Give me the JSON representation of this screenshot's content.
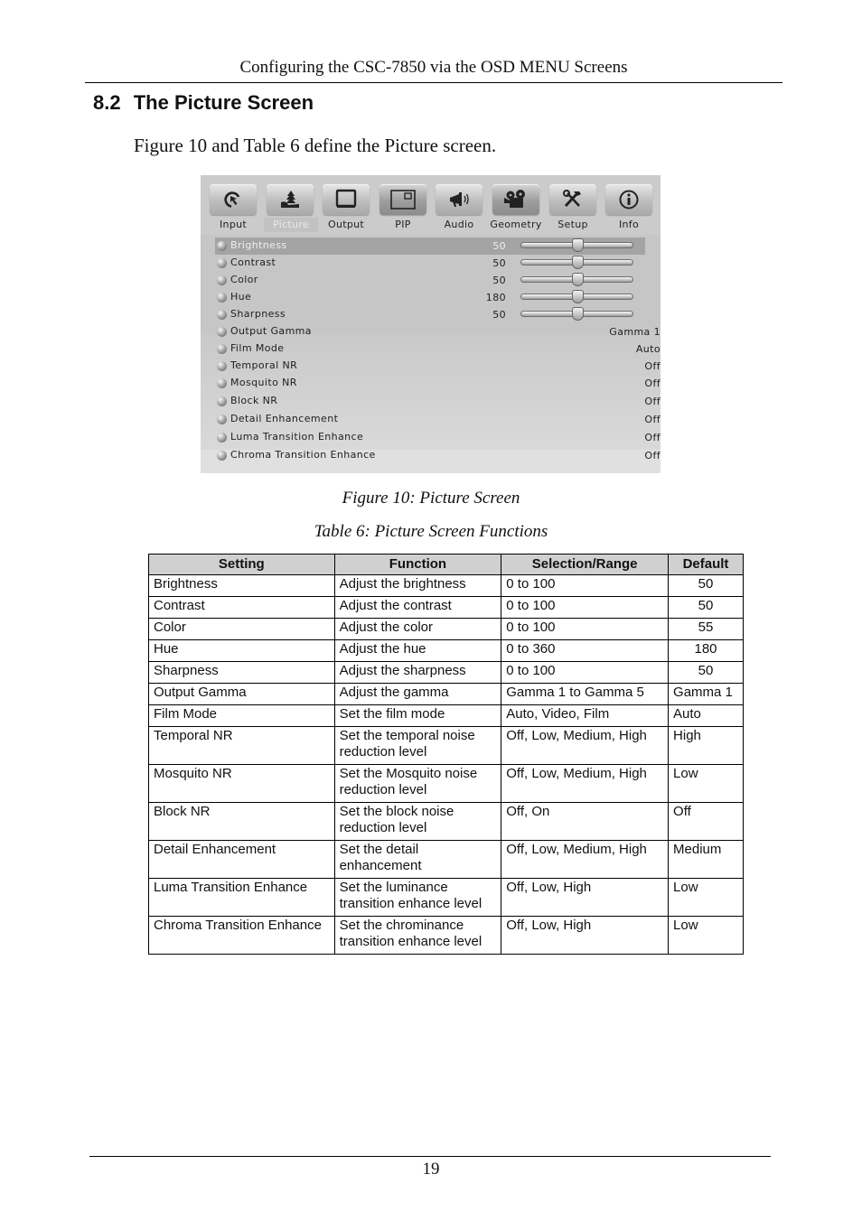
{
  "running_header": "Configuring the CSC-7850 via the OSD MENU Screens",
  "section": {
    "number": "8.2",
    "title": "The Picture Screen"
  },
  "intro_text": "Figure 10 and Table 6 define the Picture screen.",
  "osd": {
    "tabs": [
      {
        "label": "Input",
        "icon": "cursor-arrow-icon",
        "active": false
      },
      {
        "label": "Picture",
        "icon": "landscape-tree-icon",
        "active": true
      },
      {
        "label": "Output",
        "icon": "tv-monitor-icon",
        "active": false
      },
      {
        "label": "PIP",
        "icon": "picture-in-picture-icon",
        "active": false
      },
      {
        "label": "Audio",
        "icon": "megaphone-icon",
        "active": false
      },
      {
        "label": "Geometry",
        "icon": "film-projector-icon",
        "active": false
      },
      {
        "label": "Setup",
        "icon": "tools-icon",
        "active": false
      },
      {
        "label": "Info",
        "icon": "info-icon",
        "active": false
      }
    ],
    "items": [
      {
        "name": "Brightness",
        "value": "50",
        "slider": 0.5,
        "selected": true
      },
      {
        "name": "Contrast",
        "value": "50",
        "slider": 0.5
      },
      {
        "name": "Color",
        "value": "50",
        "slider": 0.5
      },
      {
        "name": "Hue",
        "value": "180",
        "slider": 0.5
      },
      {
        "name": "Sharpness",
        "value": "50",
        "slider": 0.5
      },
      {
        "name": "Output Gamma",
        "option": "Gamma 1"
      },
      {
        "name": "Film Mode",
        "option": "Auto"
      },
      {
        "name": "Temporal NR",
        "option": "Off"
      },
      {
        "name": "Mosquito NR",
        "option": "Off"
      },
      {
        "name": "Block NR",
        "option": "Off"
      },
      {
        "name": "Detail Enhancement",
        "option": "Off"
      },
      {
        "name": "Luma Transition Enhance",
        "option": "Off"
      },
      {
        "name": "Chroma Transition Enhance",
        "option": "Off"
      }
    ]
  },
  "figure_caption": "Figure 10: Picture Screen",
  "table_caption": "Table 6: Picture Screen Functions",
  "table": {
    "headers": [
      "Setting",
      "Function",
      "Selection/Range",
      "Default"
    ],
    "rows": [
      [
        "Brightness",
        "Adjust the brightness",
        "0 to 100",
        "50"
      ],
      [
        "Contrast",
        "Adjust the contrast",
        "0 to 100",
        "50"
      ],
      [
        "Color",
        "Adjust the color",
        "0 to 100",
        "55"
      ],
      [
        "Hue",
        "Adjust the hue",
        "0 to 360",
        "180"
      ],
      [
        "Sharpness",
        "Adjust the sharpness",
        "0 to 100",
        "50"
      ],
      [
        "Output Gamma",
        "Adjust the gamma",
        "Gamma 1 to Gamma 5",
        "Gamma 1"
      ],
      [
        "Film Mode",
        "Set the film mode",
        "Auto, Video, Film",
        "Auto"
      ],
      [
        "Temporal NR",
        "Set the temporal noise reduction level",
        "Off, Low, Medium, High",
        "High"
      ],
      [
        "Mosquito NR",
        "Set the Mosquito noise reduction level",
        "Off, Low, Medium, High",
        "Low"
      ],
      [
        "Block NR",
        "Set the block noise reduction level",
        "Off, On",
        "Off"
      ],
      [
        "Detail Enhancement",
        "Set the detail enhancement",
        "Off, Low, Medium, High",
        "Medium"
      ],
      [
        "Luma Transition Enhance",
        "Set the luminance transition enhance level",
        "Off, Low, High",
        "Low"
      ],
      [
        "Chroma Transition Enhance",
        "Set the chrominance transition enhance level",
        "Off, Low, High",
        "Low"
      ]
    ]
  },
  "page_number": "19"
}
